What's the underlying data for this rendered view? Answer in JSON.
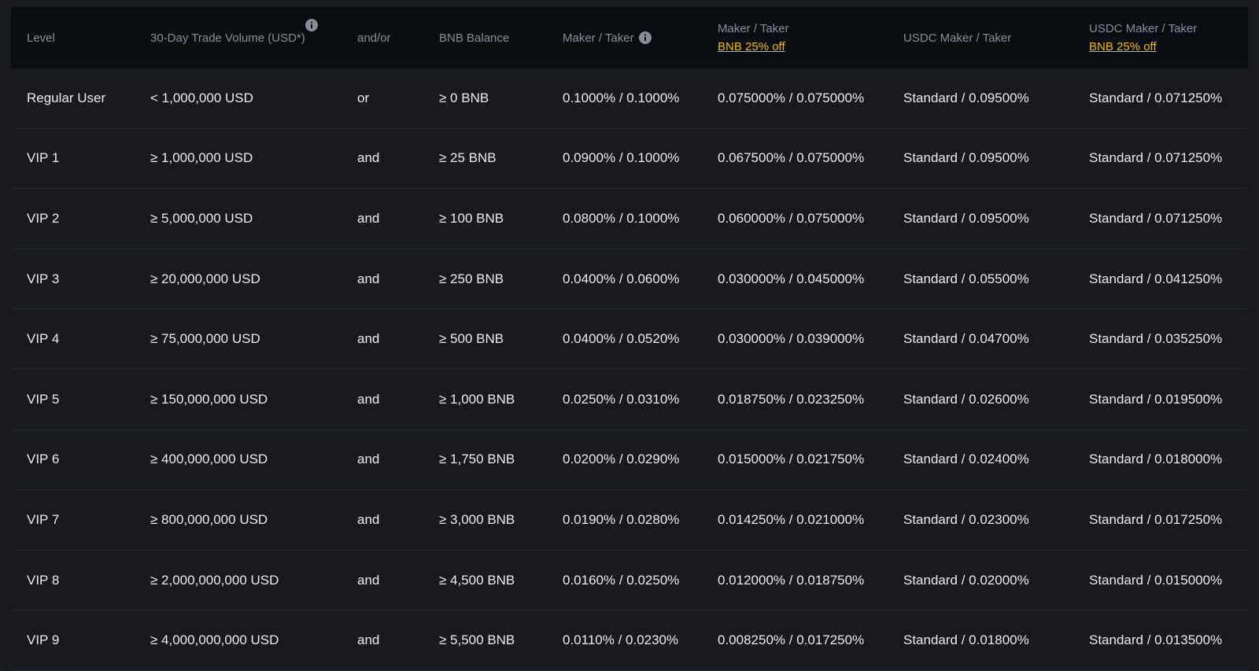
{
  "table": {
    "headers": {
      "level": "Level",
      "volume_line1": "30-Day Trade Volume",
      "volume_line2": "(USD*)",
      "andor": "and/or",
      "bnb_balance": "BNB Balance",
      "maker_taker": "Maker / Taker",
      "maker_taker_bnb": "Maker / Taker",
      "maker_taker_bnb_promo": "BNB 25% off",
      "usdc_maker_taker": "USDC Maker / Taker",
      "usdc_maker_taker_bnb": "USDC Maker / Taker",
      "usdc_maker_taker_bnb_promo": "BNB 25% off"
    },
    "icons": {
      "volume_info": "info-icon",
      "maker_taker_info": "info-icon"
    },
    "rows": [
      {
        "level": "Regular User",
        "volume": "< 1,000,000 USD",
        "andor": "or",
        "bnb": "≥ 0 BNB",
        "maker_taker": "0.1000% / 0.1000%",
        "maker_taker_bnb": "0.075000% / 0.075000%",
        "usdc": "Standard / 0.09500%",
        "usdc_bnb": "Standard / 0.071250%"
      },
      {
        "level": "VIP 1",
        "volume": "≥ 1,000,000 USD",
        "andor": "and",
        "bnb": "≥ 25 BNB",
        "maker_taker": "0.0900% / 0.1000%",
        "maker_taker_bnb": "0.067500% / 0.075000%",
        "usdc": "Standard / 0.09500%",
        "usdc_bnb": "Standard / 0.071250%"
      },
      {
        "level": "VIP 2",
        "volume": "≥ 5,000,000 USD",
        "andor": "and",
        "bnb": "≥ 100 BNB",
        "maker_taker": "0.0800% / 0.1000%",
        "maker_taker_bnb": "0.060000% / 0.075000%",
        "usdc": "Standard / 0.09500%",
        "usdc_bnb": "Standard / 0.071250%"
      },
      {
        "level": "VIP 3",
        "volume": "≥ 20,000,000 USD",
        "andor": "and",
        "bnb": "≥ 250 BNB",
        "maker_taker": "0.0400% / 0.0600%",
        "maker_taker_bnb": "0.030000% / 0.045000%",
        "usdc": "Standard / 0.05500%",
        "usdc_bnb": "Standard / 0.041250%"
      },
      {
        "level": "VIP 4",
        "volume": "≥ 75,000,000 USD",
        "andor": "and",
        "bnb": "≥ 500 BNB",
        "maker_taker": "0.0400% / 0.0520%",
        "maker_taker_bnb": "0.030000% / 0.039000%",
        "usdc": "Standard / 0.04700%",
        "usdc_bnb": "Standard / 0.035250%"
      },
      {
        "level": "VIP 5",
        "volume": "≥ 150,000,000 USD",
        "andor": "and",
        "bnb": "≥ 1,000 BNB",
        "maker_taker": "0.0250% / 0.0310%",
        "maker_taker_bnb": "0.018750% / 0.023250%",
        "usdc": "Standard / 0.02600%",
        "usdc_bnb": "Standard / 0.019500%"
      },
      {
        "level": "VIP 6",
        "volume": "≥ 400,000,000 USD",
        "andor": "and",
        "bnb": "≥ 1,750 BNB",
        "maker_taker": "0.0200% / 0.0290%",
        "maker_taker_bnb": "0.015000% / 0.021750%",
        "usdc": "Standard / 0.02400%",
        "usdc_bnb": "Standard / 0.018000%"
      },
      {
        "level": "VIP 7",
        "volume": "≥ 800,000,000 USD",
        "andor": "and",
        "bnb": "≥ 3,000 BNB",
        "maker_taker": "0.0190% / 0.0280%",
        "maker_taker_bnb": "0.014250% / 0.021000%",
        "usdc": "Standard / 0.02300%",
        "usdc_bnb": "Standard / 0.017250%"
      },
      {
        "level": "VIP 8",
        "volume": "≥ 2,000,000,000 USD",
        "andor": "and",
        "bnb": "≥ 4,500 BNB",
        "maker_taker": "0.0160% / 0.0250%",
        "maker_taker_bnb": "0.012000% / 0.018750%",
        "usdc": "Standard / 0.02000%",
        "usdc_bnb": "Standard / 0.015000%"
      },
      {
        "level": "VIP 9",
        "volume": "≥ 4,000,000,000 USD",
        "andor": "and",
        "bnb": "≥ 5,500 BNB",
        "maker_taker": "0.0110% / 0.0230%",
        "maker_taker_bnb": "0.008250% / 0.017250%",
        "usdc": "Standard / 0.01800%",
        "usdc_bnb": "Standard / 0.013500%"
      }
    ]
  },
  "colors": {
    "background": "#181a20",
    "header_background": "#0b0e11",
    "header_text": "#848e9c",
    "cell_text": "#eaecef",
    "promo": "#f0b90b",
    "row_divider": "#262a31"
  }
}
